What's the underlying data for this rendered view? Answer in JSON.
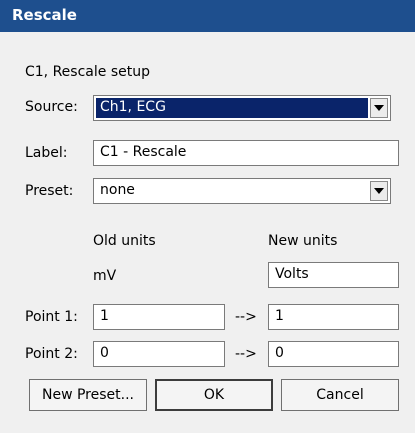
{
  "window": {
    "title": "Rescale"
  },
  "header": {
    "setup_text": "C1, Rescale setup"
  },
  "source": {
    "label": "Source:",
    "value": "Ch1, ECG"
  },
  "label_field": {
    "label": "Label:",
    "value": "C1 - Rescale"
  },
  "preset": {
    "label": "Preset:",
    "value": "none"
  },
  "units": {
    "old_heading": "Old units",
    "new_heading": "New units",
    "old_value": "mV",
    "new_value": "Volts"
  },
  "point1": {
    "label": "Point 1:",
    "old_value": "1",
    "arrow": "-->",
    "new_value": "1"
  },
  "point2": {
    "label": "Point 2:",
    "old_value": "0",
    "arrow": "-->",
    "new_value": "0"
  },
  "buttons": {
    "new_preset": "New Preset...",
    "ok": "OK",
    "cancel": "Cancel"
  }
}
